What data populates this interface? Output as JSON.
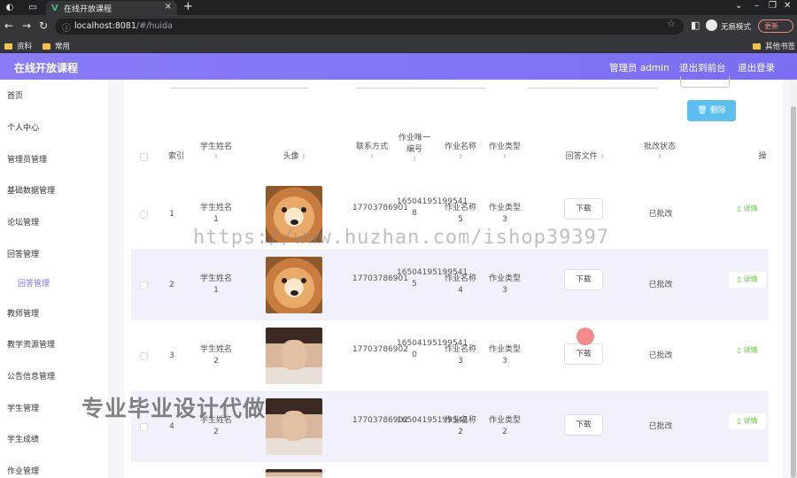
{
  "browser": {
    "tab_title": "在线开放课程",
    "url_host": "localhost:8081",
    "url_path": "/#/huida",
    "incognito_label": "无痕模式",
    "update_label": "更新",
    "bookmarks": [
      "资料",
      "常用"
    ],
    "other_bookmarks": "其他书签"
  },
  "header": {
    "title": "在线开放课程",
    "admin": "管理员 admin",
    "to_front": "退出到前台",
    "logout": "退出登录"
  },
  "sidebar": {
    "items": [
      {
        "label": "首页"
      },
      {
        "label": "个人中心"
      },
      {
        "label": "管理员管理"
      },
      {
        "label": "基础数据管理"
      },
      {
        "label": "论坛管理"
      },
      {
        "label": "回答管理"
      },
      {
        "label": "回答管理",
        "sub": true,
        "active": true
      },
      {
        "label": "教师管理"
      },
      {
        "label": "教学资源管理"
      },
      {
        "label": "公告信息管理"
      },
      {
        "label": "学生管理"
      },
      {
        "label": "学生成绩"
      },
      {
        "label": "作业管理"
      }
    ]
  },
  "toolbar": {
    "delete_label": "删除",
    "delete_icon": "trash-icon"
  },
  "table": {
    "headers": [
      "索引",
      "学生姓名",
      "头像",
      "联系方式",
      "作业唯一编号",
      "作业名称",
      "作业类型",
      "回答文件",
      "批改状态",
      "操"
    ],
    "download_label": "下载",
    "detail_label": "详情",
    "rows": [
      {
        "index": "1",
        "name": "学生姓名1",
        "avatar": "shiba",
        "phone": "17703786901",
        "code": "16504195199541 8",
        "work": "作业名称5",
        "type": "作业类型3",
        "status": "已批改"
      },
      {
        "index": "2",
        "name": "学生姓名1",
        "avatar": "shiba",
        "phone": "17703786901",
        "code": "16504195199541 5",
        "work": "作业名称4",
        "type": "作业类型3",
        "status": "已批改"
      },
      {
        "index": "3",
        "name": "学生姓名2",
        "avatar": "person",
        "phone": "17703786902",
        "code": "16504195199541 0",
        "work": "作业名称3",
        "type": "作业类型3",
        "status": "已批改"
      },
      {
        "index": "4",
        "name": "学生姓名2",
        "avatar": "person",
        "phone": "17703786902",
        "code": "16504195199542",
        "work": "作业名称2",
        "type": "作业类型2",
        "status": "已批改"
      }
    ]
  },
  "overlays": {
    "url_watermark": "https://www.huzhan.com/ishop39397",
    "promo": "专业毕业设计代做"
  }
}
